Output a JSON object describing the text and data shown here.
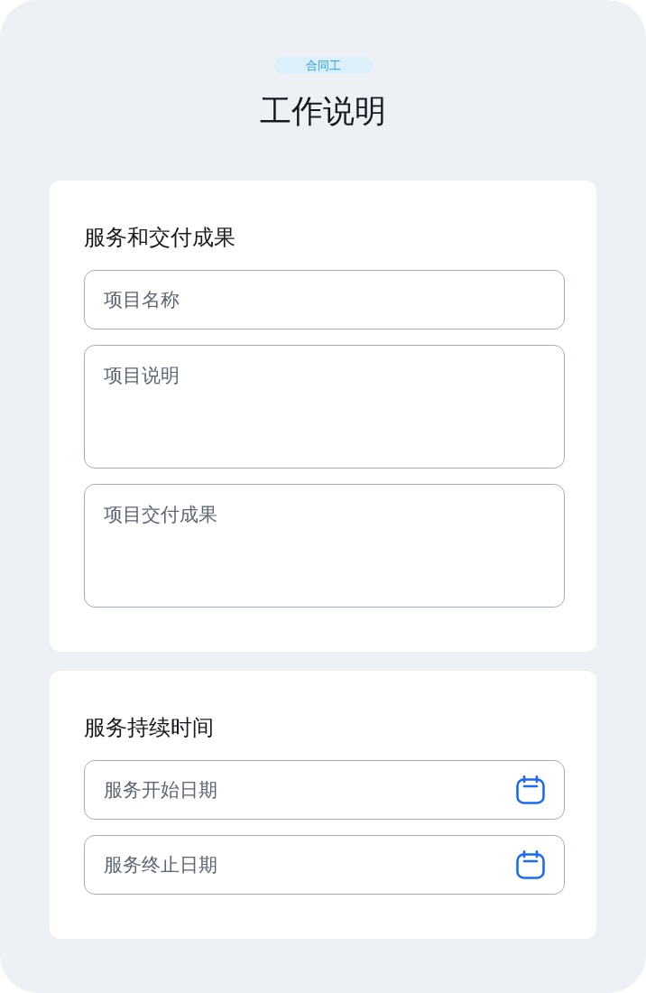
{
  "badge": "合同工",
  "title": "工作说明",
  "sections": [
    {
      "title": "服务和交付成果",
      "fields": [
        {
          "kind": "text",
          "placeholder": "项目名称"
        },
        {
          "kind": "textarea",
          "placeholder": "项目说明"
        },
        {
          "kind": "textarea",
          "placeholder": "项目交付成果"
        }
      ]
    },
    {
      "title": "服务持续时间",
      "fields": [
        {
          "kind": "date",
          "placeholder": "服务开始日期"
        },
        {
          "kind": "date",
          "placeholder": "服务终止日期"
        }
      ]
    }
  ]
}
